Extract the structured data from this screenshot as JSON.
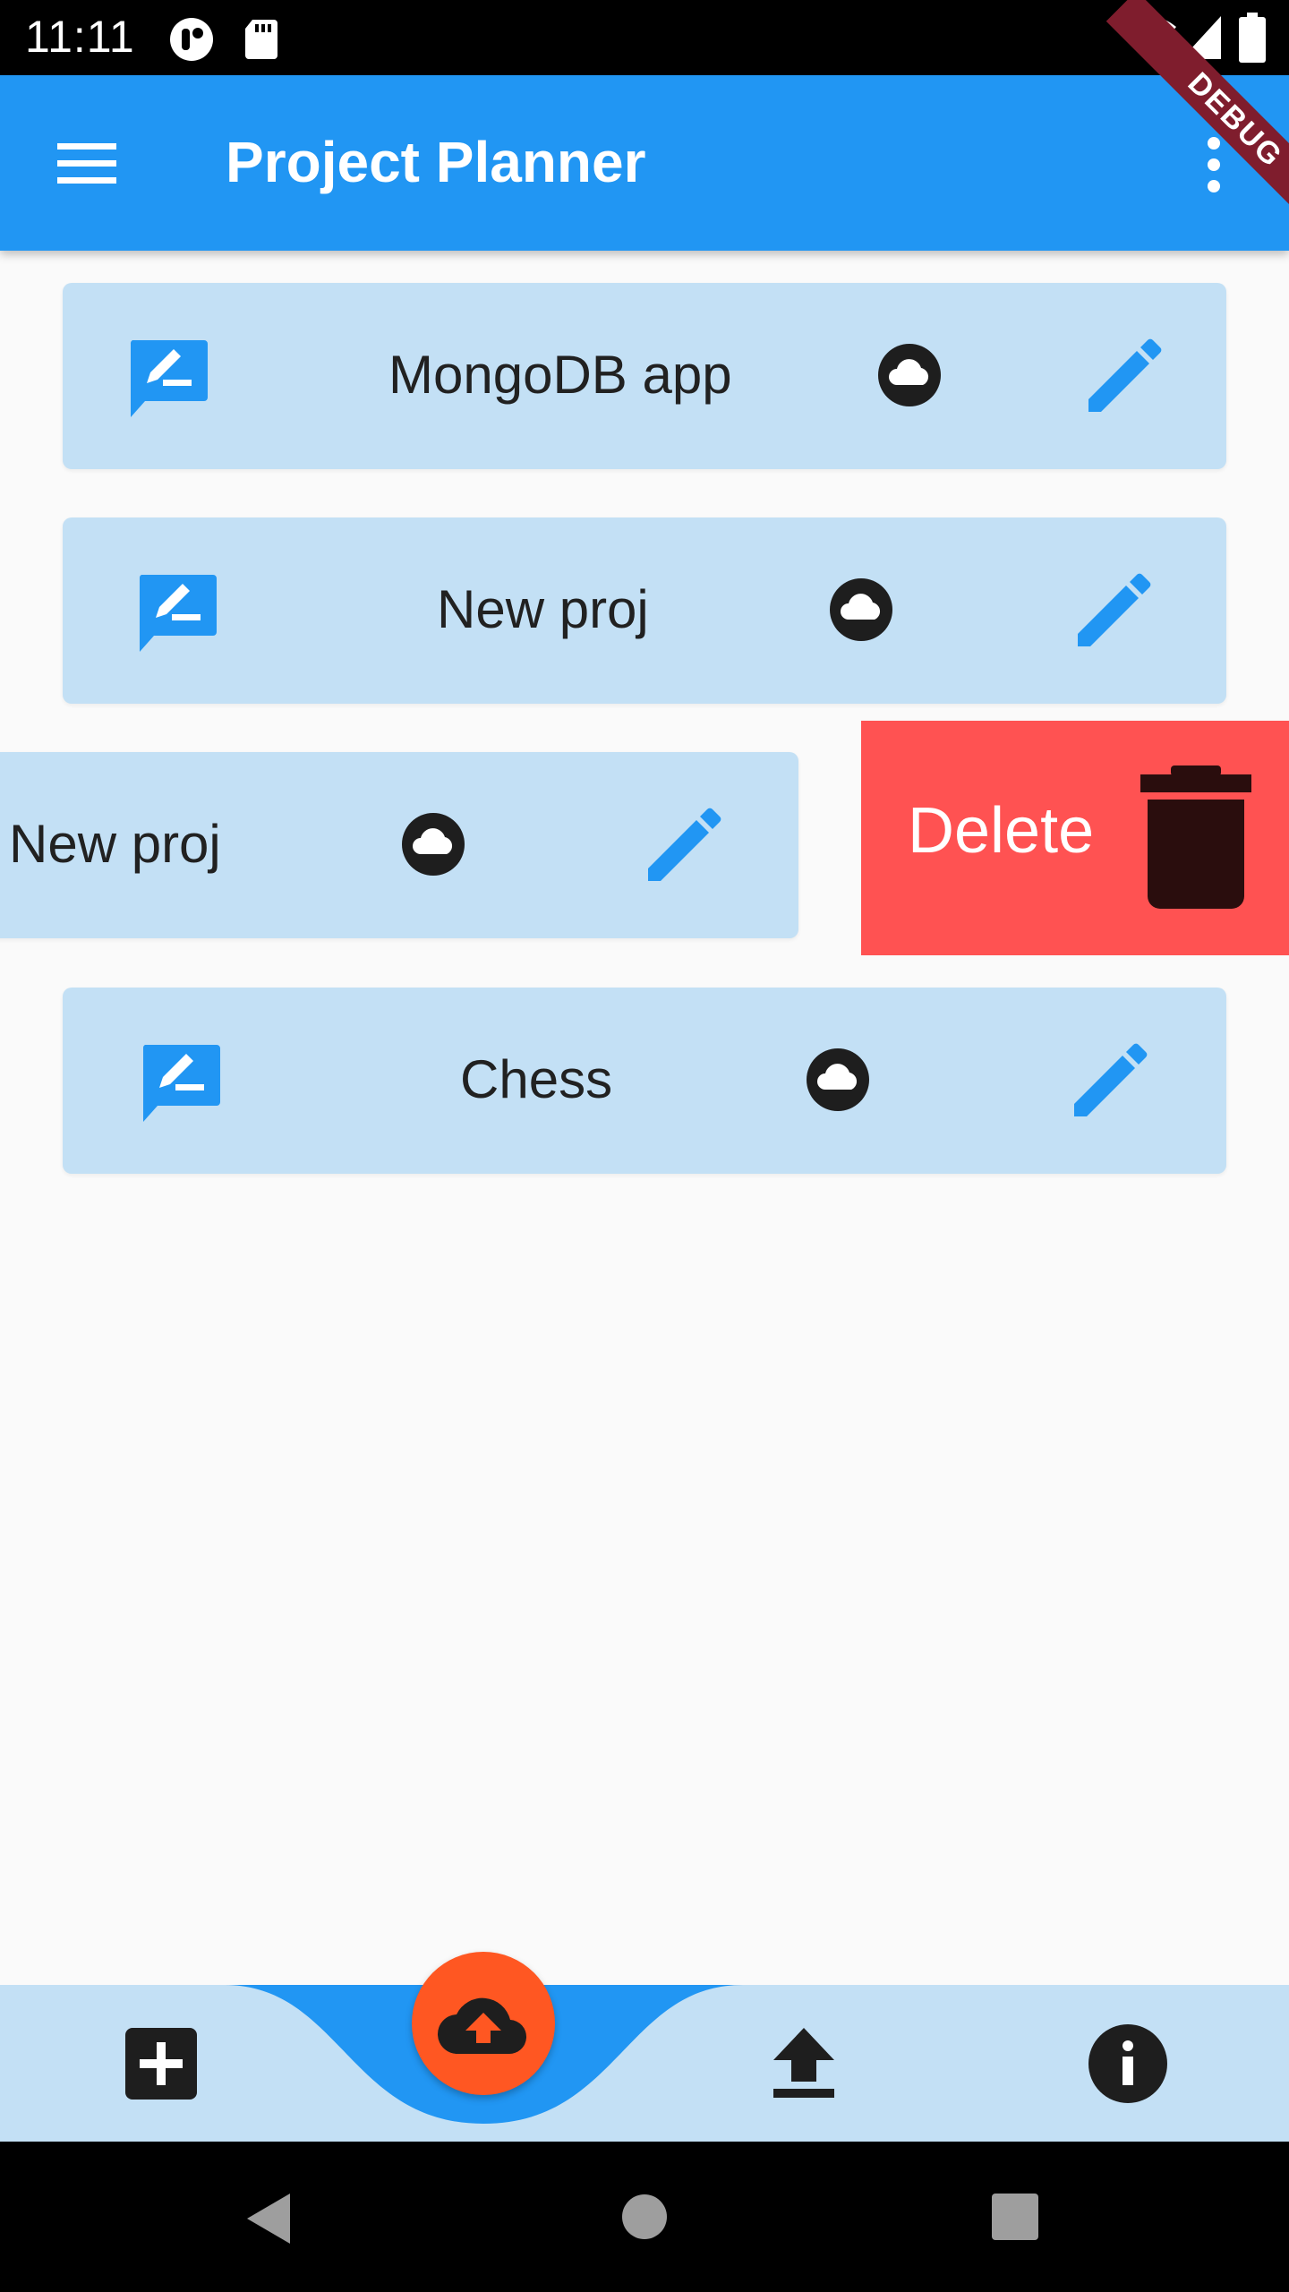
{
  "status_bar": {
    "time": "11:11",
    "icons": [
      "tap-icon",
      "sd-card-icon",
      "wifi-icon",
      "signal-icon",
      "battery-icon"
    ]
  },
  "debug_banner": {
    "label": "DEBUG"
  },
  "app_bar": {
    "title": "Project Planner",
    "menu_icon": "hamburger-menu-icon",
    "overflow_icon": "more-vert-icon"
  },
  "projects": [
    {
      "title": "MongoDB app",
      "leading_icon": "rate-review-icon",
      "status_icon": "cloud-circle-icon",
      "action_icon": "edit-pencil-icon"
    },
    {
      "title": "New proj",
      "leading_icon": "rate-review-icon",
      "status_icon": "cloud-circle-icon",
      "action_icon": "edit-pencil-icon"
    },
    {
      "title": "New proj",
      "leading_icon": "rate-review-icon",
      "status_icon": "cloud-circle-icon",
      "action_icon": "edit-pencil-icon",
      "swiped": true
    },
    {
      "title": "Chess",
      "leading_icon": "rate-review-icon",
      "status_icon": "cloud-circle-icon",
      "action_icon": "edit-pencil-icon"
    }
  ],
  "swipe_action": {
    "label": "Delete",
    "icon": "trash-icon",
    "color": "#ff5252"
  },
  "bottom_nav": {
    "items": [
      {
        "icon": "add-box-icon"
      },
      {
        "icon": "cloud-upload-icon",
        "fab": true,
        "color": "#ff5722"
      },
      {
        "icon": "upload-icon"
      },
      {
        "icon": "info-icon"
      }
    ]
  },
  "system_nav": {
    "icons": [
      "back-icon",
      "home-icon",
      "recents-icon"
    ]
  },
  "colors": {
    "primary": "#2196f3",
    "card": "#c3e0f5",
    "fab": "#ff5722",
    "delete": "#ff5252",
    "background": "#fafafa"
  }
}
